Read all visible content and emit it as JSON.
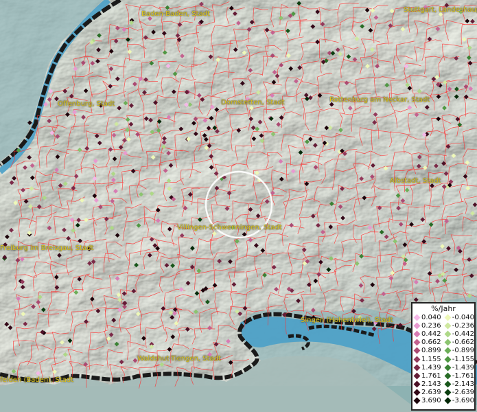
{
  "cities": [
    {
      "name": "Baden-Baden, Stadt",
      "id": "baden-baden"
    },
    {
      "name": "Stuttgart, Landeshaup",
      "id": "stuttgart"
    },
    {
      "name": "Offenburg, Stadt",
      "id": "offenburg"
    },
    {
      "name": "Dornstetten, Stadt",
      "id": "dornstetten"
    },
    {
      "name": "Rottenburg am Neckar, Stadt",
      "id": "rottenburg"
    },
    {
      "name": "Albstadt, Stadt",
      "id": "albstadt"
    },
    {
      "name": "Villingen-Schwenningen, Stadt",
      "id": "villingen-schwenningen"
    },
    {
      "name": "Freiburg im Breisgau, Stadt",
      "id": "freiburg"
    },
    {
      "name": "Singen (Hohentwiel), Stadt",
      "id": "singen"
    },
    {
      "name": "Waldshut-Tiengen, Stadt",
      "id": "waldshut-tiengen"
    },
    {
      "name": "felden (Baden), Stadt",
      "id": "rheinfelden"
    }
  ],
  "legend": {
    "title": "%/Jahr",
    "positive": [
      {
        "label": "0.040",
        "color": "#f5b8e8"
      },
      {
        "label": "0.236",
        "color": "#e89ad0"
      },
      {
        "label": "0.442",
        "color": "#d87cb4"
      },
      {
        "label": "0.662",
        "color": "#c4628f"
      },
      {
        "label": "0.899",
        "color": "#ac4a72"
      },
      {
        "label": "1.155",
        "color": "#943a5c"
      },
      {
        "label": "1.439",
        "color": "#7c2a48"
      },
      {
        "label": "1.761",
        "color": "#641c36"
      },
      {
        "label": "2.143",
        "color": "#4c1026"
      },
      {
        "label": "2.639",
        "color": "#340818"
      },
      {
        "label": "3.690",
        "color": "#1c020a"
      }
    ],
    "negative": [
      {
        "label": "-0.040",
        "color": "#eef8b8"
      },
      {
        "label": "-0.236",
        "color": "#cfe8a0"
      },
      {
        "label": "-0.442",
        "color": "#aed888"
      },
      {
        "label": "-0.662",
        "color": "#8cc470"
      },
      {
        "label": "-0.899",
        "color": "#6cae58"
      },
      {
        "label": "-1.155",
        "color": "#509844"
      },
      {
        "label": "-1.439",
        "color": "#3a8234"
      },
      {
        "label": "-1.761",
        "color": "#286c26"
      },
      {
        "label": "-2.143",
        "color": "#18561a"
      },
      {
        "label": "-2.639",
        "color": "#0c3e10"
      },
      {
        "label": "-3.690",
        "color": "#042808"
      }
    ]
  },
  "colors": {
    "borders": "#ff3030",
    "water": "#4aa0c8",
    "coast": "#1a1a1a",
    "label": "#e0c820",
    "highlight_ring": "#ffffff"
  }
}
